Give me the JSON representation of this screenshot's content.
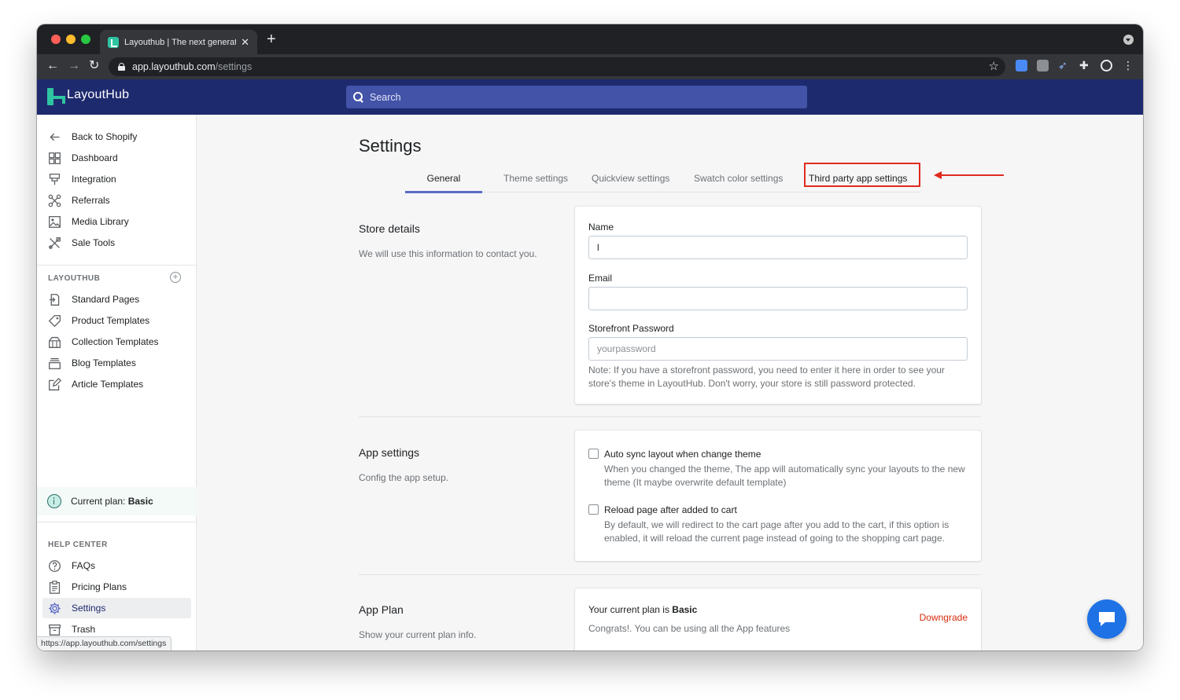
{
  "browser": {
    "tab_title": "Layouthub | The next generation",
    "url_host": "app.layouthub.com",
    "url_path": "/settings",
    "hover_url": "https://app.layouthub.com/settings"
  },
  "header": {
    "logo": "LayoutHub",
    "search_placeholder": "Search"
  },
  "sidebar": {
    "top_items": [
      {
        "label": "Back to Shopify",
        "icon": "arrow-left-icon"
      },
      {
        "label": "Dashboard",
        "icon": "dashboard-icon"
      },
      {
        "label": "Integration",
        "icon": "integration-icon"
      },
      {
        "label": "Referrals",
        "icon": "referrals-icon"
      },
      {
        "label": "Media Library",
        "icon": "image-icon"
      },
      {
        "label": "Sale Tools",
        "icon": "tools-icon"
      }
    ],
    "layouthub_heading": "LAYOUTHUB",
    "layouthub_items": [
      {
        "label": "Standard Pages",
        "icon": "page-icon"
      },
      {
        "label": "Product Templates",
        "icon": "tag-icon"
      },
      {
        "label": "Collection Templates",
        "icon": "collection-icon"
      },
      {
        "label": "Blog Templates",
        "icon": "blog-icon"
      },
      {
        "label": "Article Templates",
        "icon": "edit-icon"
      }
    ],
    "plan_label": "Current plan:",
    "plan_value": "Basic",
    "help_heading": "HELP CENTER",
    "help_items": [
      {
        "label": "FAQs",
        "icon": "question-icon"
      },
      {
        "label": "Pricing Plans",
        "icon": "clipboard-icon"
      },
      {
        "label": "Settings",
        "icon": "gear-icon",
        "active": true
      },
      {
        "label": "Trash",
        "icon": "trash-icon"
      }
    ]
  },
  "main": {
    "title": "Settings",
    "tabs": [
      {
        "label": "General",
        "active": true
      },
      {
        "label": "Theme settings"
      },
      {
        "label": "Quickview settings"
      },
      {
        "label": "Swatch color settings"
      },
      {
        "label": "Third party app settings"
      }
    ],
    "store": {
      "title": "Store details",
      "desc": "We will use this information to contact you.",
      "name_label": "Name",
      "name_value": "l",
      "email_label": "Email",
      "email_value": "",
      "password_label": "Storefront Password",
      "password_placeholder": "yourpassword",
      "note": "Note: If you have a storefront password, you need to enter it here in order to see your store's theme in LayoutHub. Don't worry, your store is still password protected."
    },
    "app": {
      "title": "App settings",
      "desc": "Config the app setup.",
      "opt1_label": "Auto sync layout when change theme",
      "opt1_help": "When you changed the theme, The app will automatically sync your layouts to the new theme (It maybe overwrite default template)",
      "opt2_label": "Reload page after added to cart",
      "opt2_help": "By default, we will redirect to the cart page after you add to the cart, if this option is enabled, it will reload the current page instead of going to the shopping cart page."
    },
    "plan": {
      "title": "App Plan",
      "desc": "Show your current plan info.",
      "current_prefix": "Your current plan is",
      "current_value": "Basic",
      "congrats": "Congrats!. You can be using all the App features",
      "downgrade": "Downgrade"
    }
  },
  "colors": {
    "header_bg": "#1e2a6e",
    "accent": "#5c6ac4",
    "highlight_red": "#e02b1e",
    "brand_green": "#2ec4a0",
    "chat_blue": "#1e72e6"
  }
}
